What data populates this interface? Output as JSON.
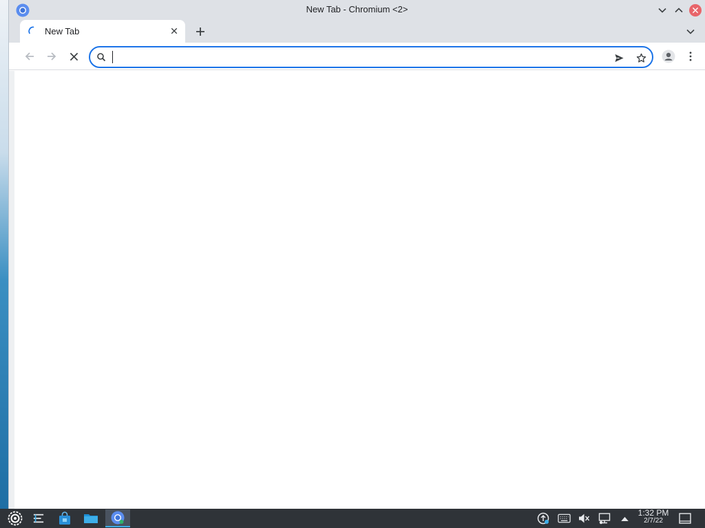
{
  "window": {
    "title": "New Tab - Chromium <2>"
  },
  "tabs": [
    {
      "title": "New Tab",
      "state": "loading"
    }
  ],
  "omnibox": {
    "value": "",
    "focused": true
  },
  "icons": {
    "app": "chromium-icon",
    "back": "arrow-left-icon",
    "forward": "arrow-right-icon",
    "stop": "close-icon",
    "search": "search-icon",
    "send": "send-icon",
    "bookmark": "star-icon",
    "profile": "profile-icon",
    "menu": "kebab-menu-icon"
  },
  "colors": {
    "accent": "#1a73e8",
    "close_button": "#e8656a",
    "titlebar": "#dee1e6",
    "taskbar": "#2f3338"
  },
  "taskbar": {
    "apps": [
      "launcher",
      "application-menu",
      "software-store",
      "file-manager",
      "chromium"
    ],
    "active_app": "chromium",
    "clock": {
      "time": "1:32 PM",
      "date": "2/7/22"
    }
  }
}
